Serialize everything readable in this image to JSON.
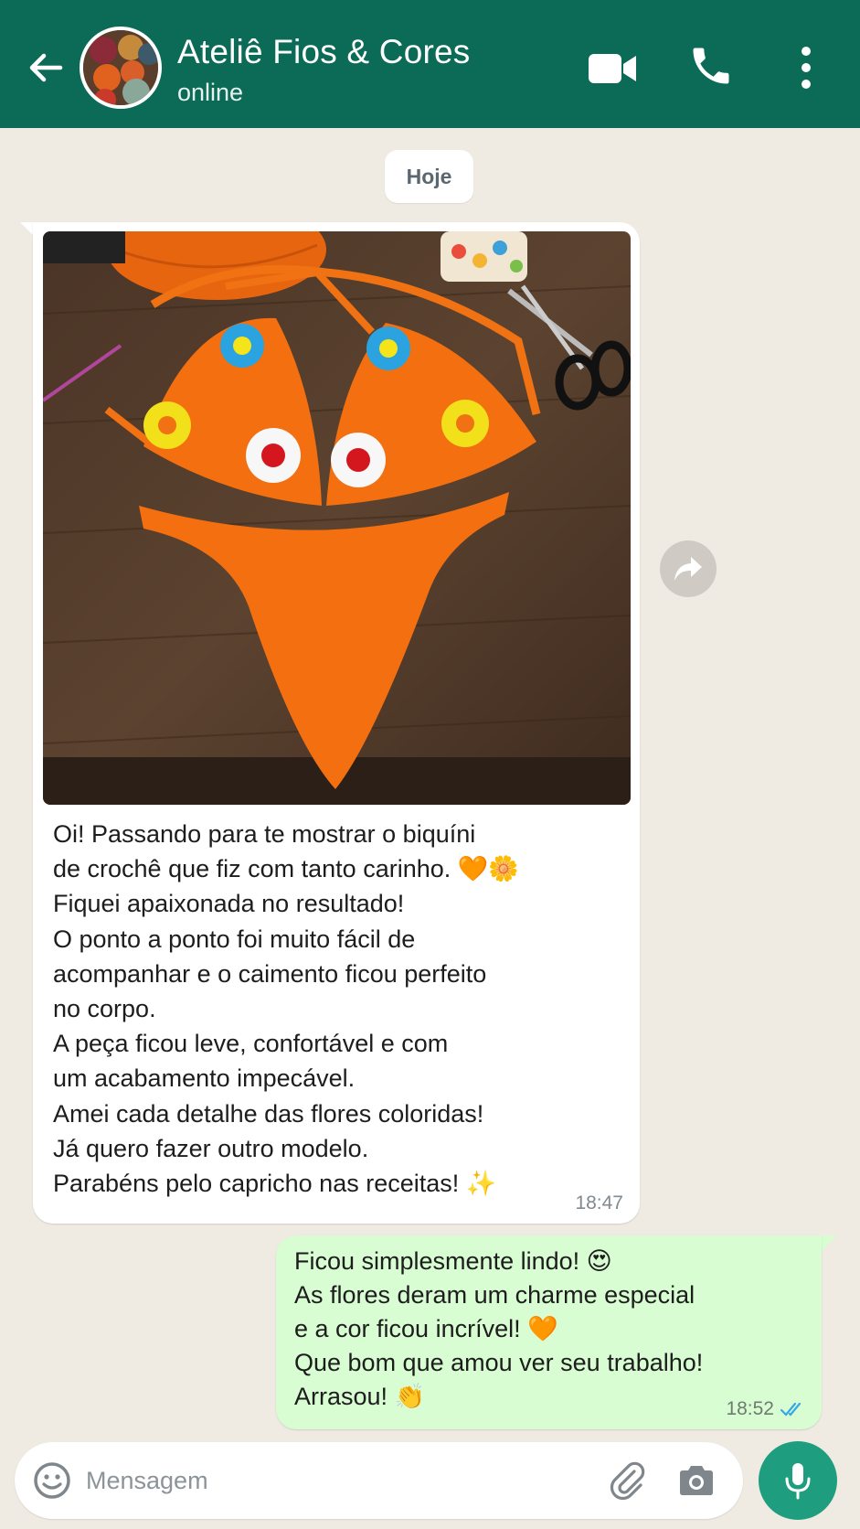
{
  "header": {
    "contact_name": "Ateliê Fios & Cores",
    "status": "online",
    "icons": [
      "back-arrow-icon",
      "video-call-icon",
      "phone-call-icon",
      "more-options-icon"
    ],
    "color": "#0b6b57"
  },
  "chat": {
    "date_label": "Hoje",
    "incoming": {
      "photo": "crochet-bikini-photo",
      "lines": [
        "Oi! Passando para te mostrar o biquíni",
        "de crochê que fiz com tanto carinho. 🧡🌼",
        "Fiquei apaixonada no resultado!",
        "O ponto a ponto foi muito fácil de",
        "acompanhar e o caimento ficou perfeito",
        "no corpo.",
        "A peça ficou leve, confortável e com",
        "um acabamento impecável.",
        "Amei cada detalhe das flores coloridas!",
        "Já quero fazer outro modelo.",
        "Parabéns pelo capricho nas receitas! ✨"
      ],
      "time": "18:47"
    },
    "outgoing": {
      "lines": [
        "Ficou simplesmente lindo! 😍",
        "As flores deram um charme especial",
        "e a cor ficou incrível! 🧡",
        "Que bom que amou ver seu trabalho!",
        "Arrasou! 👏"
      ],
      "time": "18:52",
      "status": "read",
      "bubble_color": "#d8fdd2"
    }
  },
  "composer": {
    "placeholder": "Mensagem",
    "icons": [
      "emoji-icon",
      "attach-icon",
      "camera-icon",
      "microphone-icon"
    ],
    "accent": "#1e9e7e"
  }
}
